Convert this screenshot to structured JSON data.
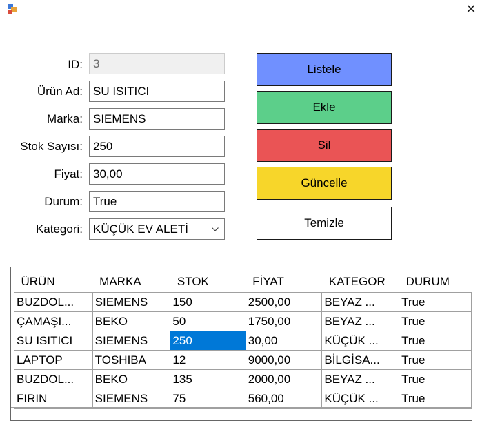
{
  "window": {
    "close_glyph": "✕"
  },
  "form": {
    "id_label": "ID:",
    "id_value": "3",
    "urun_ad_label": "Ürün Ad:",
    "urun_ad_value": "SU ISITICI",
    "marka_label": "Marka:",
    "marka_value": "SIEMENS",
    "stok_label": "Stok Sayısı:",
    "stok_value": "250",
    "fiyat_label": "Fiyat:",
    "fiyat_value": "30,00",
    "durum_label": "Durum:",
    "durum_value": "True",
    "kategori_label": "Kategori:",
    "kategori_value": "KÜÇÜK EV ALETİ"
  },
  "buttons": {
    "listele": {
      "label": "Listele",
      "color": "#7090ff"
    },
    "ekle": {
      "label": "Ekle",
      "color": "#5ccf8a"
    },
    "sil": {
      "label": "Sil",
      "color": "#ea5455"
    },
    "guncelle": {
      "label": "Güncelle",
      "color": "#f7d62a"
    },
    "temizle": {
      "label": "Temizle",
      "color": "#ffffff"
    }
  },
  "table": {
    "columns": [
      "ÜRÜN",
      "MARKA",
      "STOK",
      "FİYAT",
      "KATEGOR",
      "DURUM"
    ],
    "rows": [
      [
        "BUZDOL...",
        "SIEMENS",
        "150",
        "2500,00",
        "BEYAZ ...",
        "True"
      ],
      [
        "ÇAMAŞI...",
        "BEKO",
        "50",
        "1750,00",
        "BEYAZ ...",
        "True"
      ],
      [
        "SU ISITICI",
        "SIEMENS",
        "250",
        "30,00",
        "KÜÇÜK ...",
        "True"
      ],
      [
        "LAPTOP",
        "TOSHIBA",
        "12",
        "9000,00",
        "BİLGİSA...",
        "True"
      ],
      [
        "BUZDOL...",
        "BEKO",
        "135",
        "2000,00",
        "BEYAZ ...",
        "True"
      ],
      [
        "FIRIN",
        "SIEMENS",
        "75",
        "560,00",
        "KÜÇÜK ...",
        "True"
      ]
    ],
    "selected_cell": {
      "row": 2,
      "col": 2
    },
    "selection_color": "#0078d7"
  }
}
